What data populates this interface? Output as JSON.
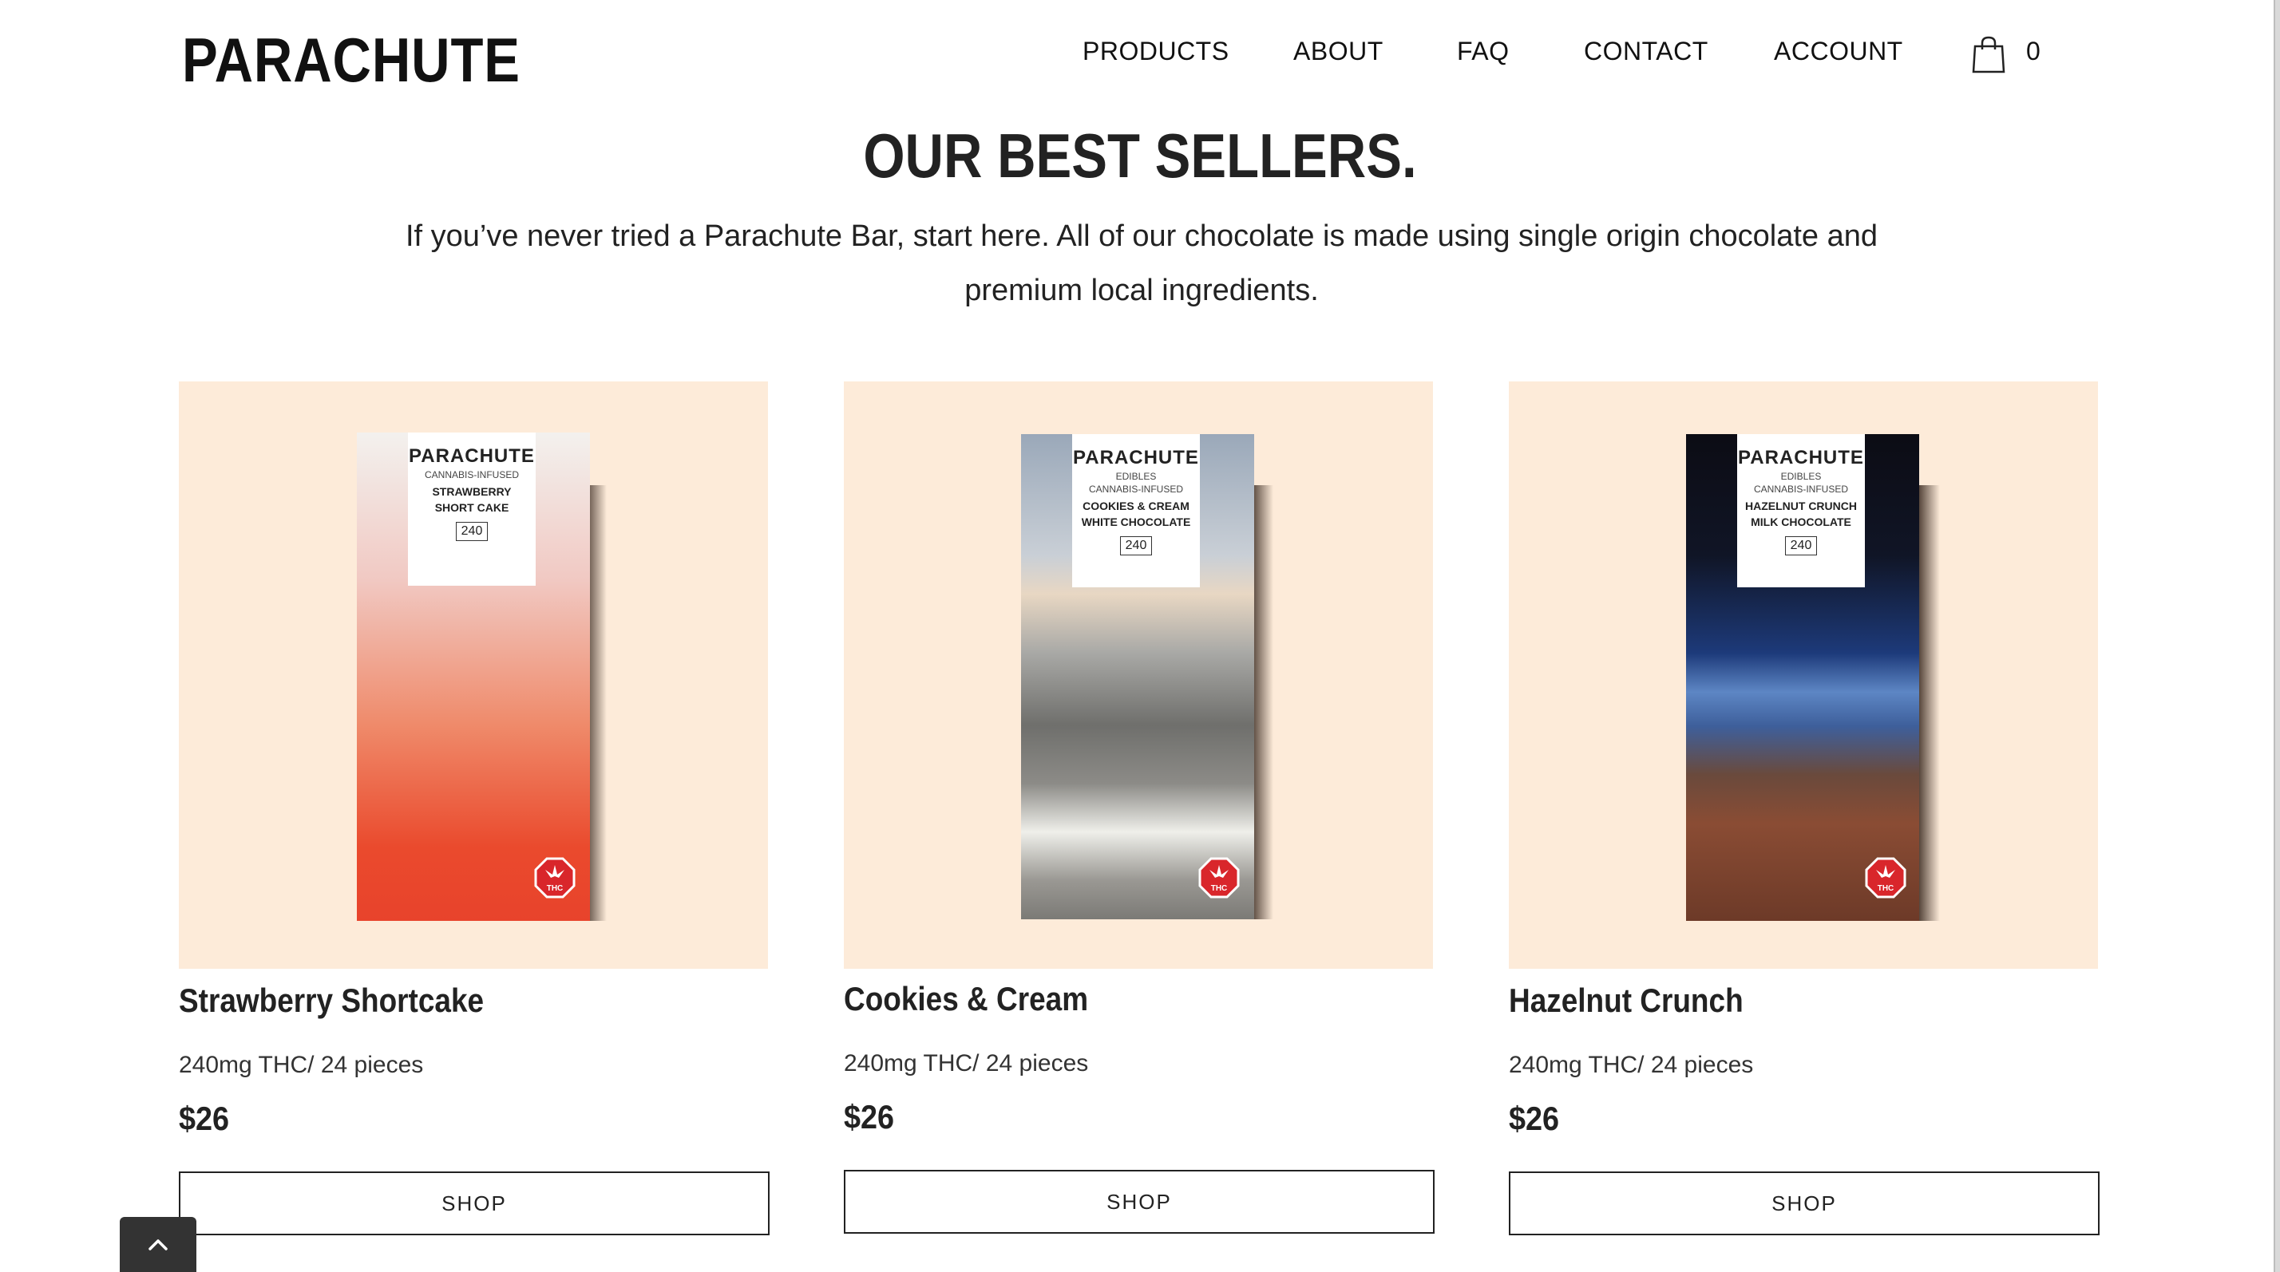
{
  "header": {
    "logo": "PARACHUTE",
    "nav": [
      "PRODUCTS",
      "ABOUT",
      "FAQ",
      "CONTACT",
      "ACCOUNT"
    ],
    "cart_count": "0"
  },
  "section": {
    "title": "OUR BEST SELLERS.",
    "intro": "If you’ve never tried a Parachute Bar, start here. All of our chocolate is made using single origin chocolate and premium local ingredients."
  },
  "products": [
    {
      "name": "Strawberry Shortcake",
      "desc": "240mg THC/ 24 pieces",
      "price": "$26",
      "button": "SHOP",
      "package": {
        "brand": "PARACHUTE",
        "sub": "",
        "type": "CANNABIS-INFUSED",
        "flavor1": "STRAWBERRY",
        "flavor2": "SHORT CAKE",
        "dose": "240",
        "badge": "THC"
      }
    },
    {
      "name": "Cookies & Cream",
      "desc": "240mg THC/ 24 pieces",
      "price": "$26",
      "button": "SHOP",
      "package": {
        "brand": "PARACHUTE",
        "sub": "EDIBLES",
        "type": "CANNABIS-INFUSED",
        "flavor1": "COOKIES & CREAM",
        "flavor2": "WHITE CHOCOLATE",
        "dose": "240",
        "badge": "THC"
      }
    },
    {
      "name": "Hazelnut Crunch",
      "desc": "240mg THC/ 24 pieces",
      "price": "$26",
      "button": "SHOP",
      "package": {
        "brand": "PARACHUTE",
        "sub": "EDIBLES",
        "type": "CANNABIS-INFUSED",
        "flavor1": "HAZELNUT CRUNCH",
        "flavor2": "MILK CHOCOLATE",
        "dose": "240",
        "badge": "THC"
      }
    }
  ],
  "icons": {
    "cart": "shopping-bag-icon",
    "back_to_top": "chevron-up-icon",
    "thc": "thc-warning-icon"
  },
  "colors": {
    "card_bg": "#fdebd9",
    "thc_red": "#d9262b",
    "text": "#222222"
  }
}
